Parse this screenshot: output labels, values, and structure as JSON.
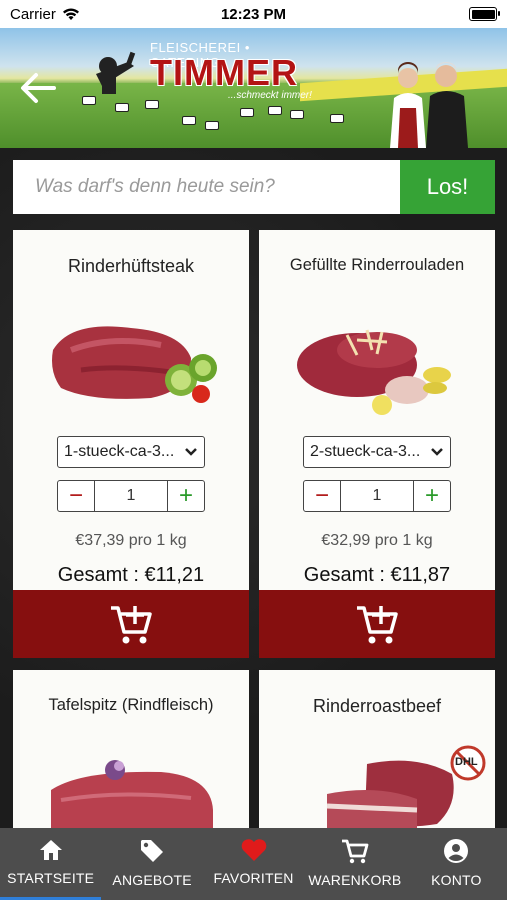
{
  "status_bar": {
    "carrier": "Carrier",
    "time": "12:23 PM"
  },
  "header": {
    "logo_top": "FLEISCHEREI • CATERING",
    "logo_brand": "TIMMER",
    "logo_tagline": "...schmeckt immer!"
  },
  "search": {
    "placeholder": "Was darf's denn heute sein?",
    "button_label": "Los!"
  },
  "products": [
    {
      "name": "Rinderhüftsteak",
      "option": "1-stueck-ca-3...",
      "quantity": "1",
      "unit_price": "€37,39 pro 1 kg",
      "total": "Gesamt : €11,21"
    },
    {
      "name": "Gefüllte Rinderrouladen",
      "option": "2-stueck-ca-3...",
      "quantity": "1",
      "unit_price": "€32,99 pro 1 kg",
      "total": "Gesamt : €11,87"
    },
    {
      "name": "Tafelspitz (Rindfleisch)"
    },
    {
      "name": "Rinderroastbeef",
      "badge": "DHL"
    }
  ],
  "tabbar": {
    "items": [
      {
        "label": "STARTSEITE",
        "icon": "home-icon"
      },
      {
        "label": "ANGEBOTE",
        "icon": "tag-icon"
      },
      {
        "label": "FAVORITEN",
        "icon": "heart-icon"
      },
      {
        "label": "WARENKORB",
        "icon": "cart-icon"
      },
      {
        "label": "KONTO",
        "icon": "account-icon"
      }
    ],
    "active_index": 0
  },
  "colors": {
    "accent_green": "#36a336",
    "cart_red": "#860f0f",
    "tabbar_bg": "#4d4d4d",
    "active_indicator": "#2f7fd9",
    "favorite_red": "#e01b1b"
  }
}
